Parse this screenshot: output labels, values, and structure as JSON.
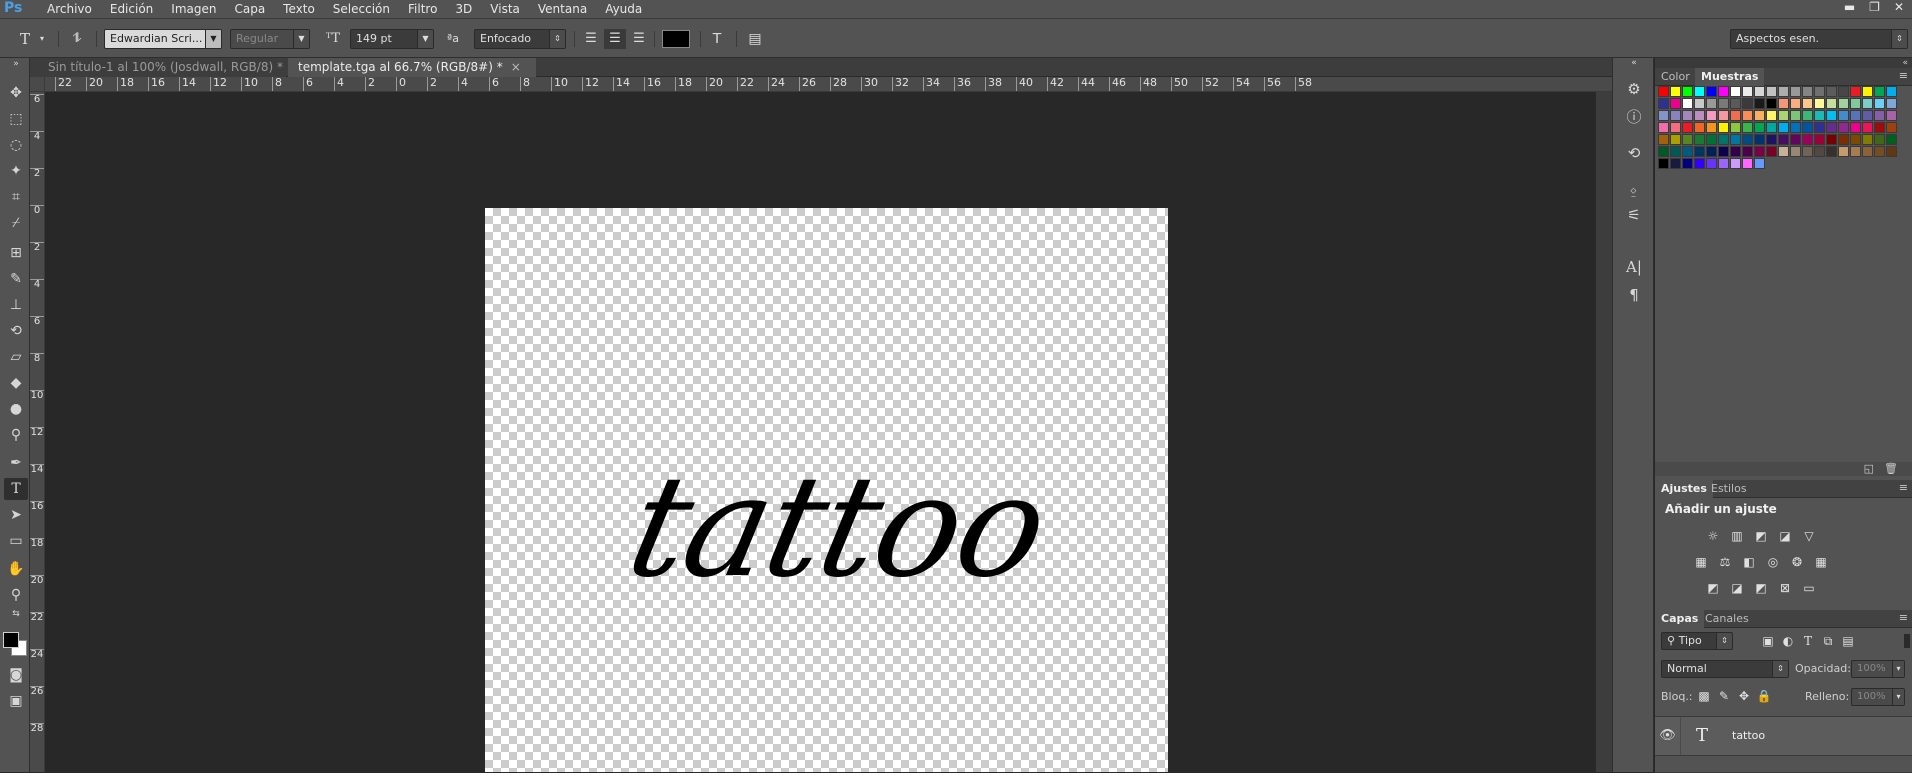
{
  "app": {
    "logo": "Ps"
  },
  "menu": [
    "Archivo",
    "Edición",
    "Imagen",
    "Capa",
    "Texto",
    "Selección",
    "Filtro",
    "3D",
    "Vista",
    "Ventana",
    "Ayuda"
  ],
  "window_controls": {
    "minimize": "▬",
    "restore": "❐",
    "close": "✕"
  },
  "options": {
    "tool_glyph": "T",
    "font_family": "Edwardian Scri...",
    "font_style": "Regular",
    "font_size": "149 pt",
    "aa_label": "ªa",
    "antialias": "Enfocado",
    "workspace": "Aspectos esen.",
    "text_color": "#000000"
  },
  "tabs": [
    {
      "label": "Sin título-1 al 100% (Josdwall, RGB/8) *",
      "active": false
    },
    {
      "label": "template.tga al 66.7% (RGB/8#) *",
      "active": true
    }
  ],
  "hruler_labels": [
    "22",
    "20",
    "18",
    "16",
    "14",
    "12",
    "10",
    "8",
    "6",
    "4",
    "2",
    "0",
    "2",
    "4",
    "6",
    "8",
    "10",
    "12",
    "14",
    "16",
    "18",
    "20",
    "22",
    "24",
    "26",
    "28",
    "30",
    "32",
    "34",
    "36",
    "38",
    "40",
    "42",
    "44",
    "46",
    "48",
    "50",
    "52",
    "54",
    "56",
    "58"
  ],
  "vruler_labels": [
    "6",
    "4",
    "2",
    "0",
    "2",
    "4",
    "6",
    "8",
    "10",
    "12",
    "14",
    "16",
    "18",
    "20",
    "22",
    "24",
    "26",
    "28"
  ],
  "canvas": {
    "text": "tattoo"
  },
  "color_panel": {
    "tabs": [
      "Color",
      "Muestras"
    ],
    "active": "Muestras"
  },
  "swatch_colors": [
    "#ff0000",
    "#ffff00",
    "#00ff00",
    "#00ffff",
    "#0000ff",
    "#ff00ff",
    "#ffffff",
    "#ebebeb",
    "#d6d6d6",
    "#c2c2c2",
    "#adadad",
    "#999999",
    "#858585",
    "#707070",
    "#5c5c5c",
    "#474747",
    "#ed1c24",
    "#fff200",
    "#00a651",
    "#00aeef",
    "#2e3192",
    "#ec008c",
    "#ffffff",
    "#c8c8c8",
    "#9a9a9a",
    "#7a7a7a",
    "#5a5a5a",
    "#3a3a3a",
    "#1a1a1a",
    "#000000",
    "#f7977a",
    "#f9ad81",
    "#fdc68a",
    "#fff79a",
    "#c4df9b",
    "#a2d39c",
    "#82ca9d",
    "#7bcdc8",
    "#6ecff6",
    "#7ea7d8",
    "#8493ca",
    "#8882be",
    "#a187be",
    "#bc8dbf",
    "#f49ac2",
    "#f6989d",
    "#f26c4f",
    "#f68e55",
    "#fbaf5c",
    "#fff467",
    "#acd372",
    "#7cc576",
    "#3bb878",
    "#1abbb4",
    "#00bff3",
    "#438ccb",
    "#5574b9",
    "#605ca8",
    "#855fa8",
    "#a763a8",
    "#f06ea9",
    "#f26d7d",
    "#ed1c24",
    "#f26522",
    "#f7941d",
    "#fff200",
    "#8dc63f",
    "#39b54a",
    "#00a651",
    "#00a99d",
    "#00aeef",
    "#0072bc",
    "#0054a6",
    "#2e3192",
    "#662d91",
    "#92278f",
    "#ec008c",
    "#ed145b",
    "#9e0b0f",
    "#a0410d",
    "#a36209",
    "#aba000",
    "#598527",
    "#1a7b30",
    "#007236",
    "#00746b",
    "#0076a3",
    "#004b80",
    "#003471",
    "#1b1464",
    "#440e62",
    "#630460",
    "#9e005d",
    "#9e0039",
    "#790000",
    "#7b2e00",
    "#7d4900",
    "#827b00",
    "#406618",
    "#005e20",
    "#005826",
    "#005952",
    "#005b7f",
    "#003663",
    "#002157",
    "#0d004c",
    "#32004b",
    "#4b0049",
    "#7b0046",
    "#7a0026",
    "#c7b299",
    "#998675",
    "#736357",
    "#534741",
    "#37302d",
    "#c69c6d",
    "#a67c52",
    "#8c6239",
    "#754c24",
    "#603913",
    "#000000",
    "#1a1a40",
    "#000080",
    "#3300ff",
    "#6633ff",
    "#9966ff",
    "#cc99ff",
    "#ff66ff",
    "#6699ff"
  ],
  "adjustments_panel": {
    "tabs": [
      "Ajustes",
      "Estilos"
    ],
    "active": "Ajustes",
    "title": "Añadir un ajuste"
  },
  "layers_panel": {
    "tabs": [
      "Capas",
      "Canales"
    ],
    "active": "Capas",
    "filter": "Tipo",
    "blend_mode": "Normal",
    "opacity_label": "Opacidad:",
    "opacity": "100%",
    "lock_label": "Bloq.:",
    "fill_label": "Relleno:",
    "fill": "100%",
    "layers": [
      {
        "name": "tattoo",
        "type": "text",
        "visible": true
      }
    ]
  }
}
